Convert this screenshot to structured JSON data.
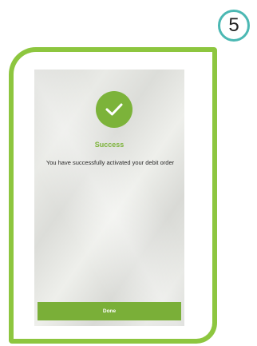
{
  "step": {
    "number": "5"
  },
  "success_screen": {
    "icon": "checkmark-icon",
    "title": "Success",
    "message": "You have successfully activated your debit order",
    "done_label": "Done"
  },
  "colors": {
    "frame": "#8dc63f",
    "badge_ring": "#4bb8b3",
    "accent": "#7cb33a",
    "button": "#7aaf38"
  }
}
